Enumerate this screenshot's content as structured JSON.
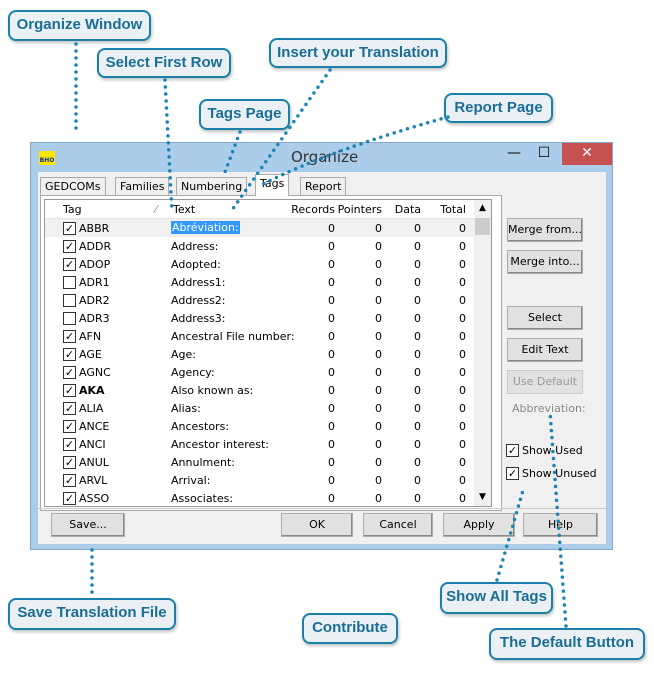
{
  "window": {
    "title": "Organize",
    "icon_label": "BHO",
    "minimize": "—",
    "maximize": "☐",
    "close": "✕"
  },
  "tabs": [
    "GEDCOMs",
    "Families",
    "Numbering",
    "Tags",
    "Report"
  ],
  "columns": [
    "Tag",
    "Text",
    "Records",
    "Pointers",
    "Data",
    "Total"
  ],
  "rows": [
    {
      "checked": true,
      "tag": "ABBR",
      "text": "Abréviation:",
      "r": 0,
      "p": 0,
      "d": 0,
      "t": 0
    },
    {
      "checked": true,
      "tag": "ADDR",
      "text": "Address:",
      "r": 0,
      "p": 0,
      "d": 0,
      "t": 0
    },
    {
      "checked": true,
      "tag": "ADOP",
      "text": "Adopted:",
      "r": 0,
      "p": 0,
      "d": 0,
      "t": 0
    },
    {
      "checked": false,
      "tag": "ADR1",
      "text": "Address1:",
      "r": 0,
      "p": 0,
      "d": 0,
      "t": 0
    },
    {
      "checked": false,
      "tag": "ADR2",
      "text": "Address2:",
      "r": 0,
      "p": 0,
      "d": 0,
      "t": 0
    },
    {
      "checked": false,
      "tag": "ADR3",
      "text": "Address3:",
      "r": 0,
      "p": 0,
      "d": 0,
      "t": 0
    },
    {
      "checked": true,
      "tag": "AFN",
      "text": "Ancestral File number:",
      "r": 0,
      "p": 0,
      "d": 0,
      "t": 0
    },
    {
      "checked": true,
      "tag": "AGE",
      "text": "Age:",
      "r": 0,
      "p": 0,
      "d": 0,
      "t": 0
    },
    {
      "checked": true,
      "tag": "AGNC",
      "text": "Agency:",
      "r": 0,
      "p": 0,
      "d": 0,
      "t": 0
    },
    {
      "checked": true,
      "tag": "AKA",
      "text": "Also known as:",
      "r": 0,
      "p": 0,
      "d": 0,
      "t": 0,
      "bold": true
    },
    {
      "checked": true,
      "tag": "ALIA",
      "text": "Alias:",
      "r": 0,
      "p": 0,
      "d": 0,
      "t": 0
    },
    {
      "checked": true,
      "tag": "ANCE",
      "text": "Ancestors:",
      "r": 0,
      "p": 0,
      "d": 0,
      "t": 0
    },
    {
      "checked": true,
      "tag": "ANCI",
      "text": "Ancestor interest:",
      "r": 0,
      "p": 0,
      "d": 0,
      "t": 0
    },
    {
      "checked": true,
      "tag": "ANUL",
      "text": "Annulment:",
      "r": 0,
      "p": 0,
      "d": 0,
      "t": 0
    },
    {
      "checked": true,
      "tag": "ARVL",
      "text": "Arrival:",
      "r": 0,
      "p": 0,
      "d": 0,
      "t": 0
    },
    {
      "checked": true,
      "tag": "ASSO",
      "text": "Associates:",
      "r": 0,
      "p": 0,
      "d": 0,
      "t": 0
    }
  ],
  "side": {
    "merge_from": "Merge from...",
    "merge_into": "Merge into...",
    "select": "Select",
    "edit_text": "Edit Text",
    "use_default": "Use Default",
    "default_text": "Abbreviation:",
    "show_used": "Show Used",
    "show_unused": "Show Unused",
    "show_used_checked": true,
    "show_unused_checked": true
  },
  "bottom": {
    "save": "Save...",
    "ok": "OK",
    "cancel": "Cancel",
    "apply": "Apply",
    "help": "Help"
  },
  "callouts": {
    "organize_window": "Organize Window",
    "select_first_row": "Select First Row",
    "insert_translation": "Insert your Translation",
    "tags_page": "Tags Page",
    "report_page": "Report Page",
    "save_file": "Save Translation File",
    "contribute": "Contribute",
    "show_all_tags": "Show All Tags",
    "default_button": "The Default Button"
  },
  "colors": {
    "callout_border": "#1a80aa",
    "callout_text": "#1a6e96",
    "callout_bg": "#eaf0f4",
    "titlebar": "#abcdea",
    "close": "#c75050",
    "selection": "#3399ff"
  }
}
